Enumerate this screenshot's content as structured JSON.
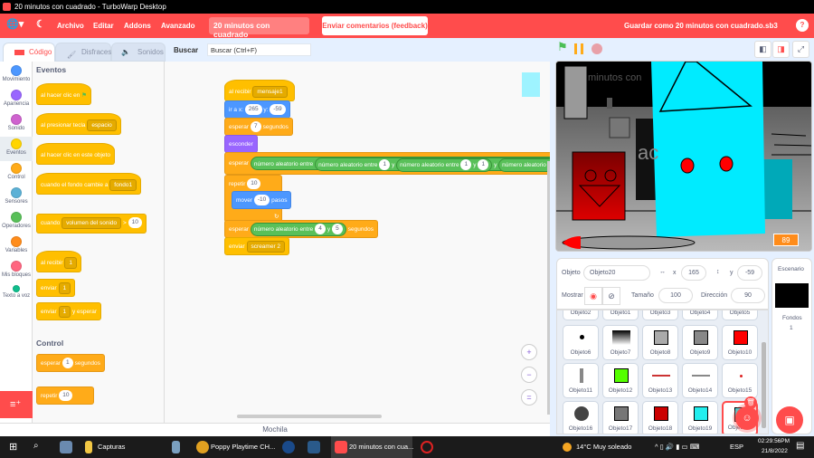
{
  "window": {
    "title": "20 minutos con cuadrado - TurboWarp Desktop"
  },
  "menubar": {
    "items": [
      "Archivo",
      "Editar",
      "Addons",
      "Avanzado"
    ],
    "project_title": "20 minutos con cuadrado",
    "feedback": "Enviar comentarios (feedback)",
    "save": "Guardar como 20 minutos con cuadrado.sb3",
    "help": "?"
  },
  "tabs": [
    {
      "label": "Código"
    },
    {
      "label": "Disfraces"
    },
    {
      "label": "Sonidos"
    }
  ],
  "search": {
    "label": "Buscar",
    "placeholder": "Buscar (Ctrl+F)"
  },
  "categories": [
    {
      "label": "Movimiento",
      "color": "#4c97ff"
    },
    {
      "label": "Apariencia",
      "color": "#9966ff"
    },
    {
      "label": "Sonido",
      "color": "#cf63cf"
    },
    {
      "label": "Eventos",
      "color": "#ffd500"
    },
    {
      "label": "Control",
      "color": "#ffab19"
    },
    {
      "label": "Sensores",
      "color": "#5cb1d6"
    },
    {
      "label": "Operadores",
      "color": "#59c059"
    },
    {
      "label": "Variables",
      "color": "#ff8c1a"
    },
    {
      "label": "Mis bloques",
      "color": "#ff6680"
    },
    {
      "label": "Texto a voz",
      "color": "#0fbd8c"
    }
  ],
  "palette": {
    "events_header": "Eventos",
    "control_header": "Control",
    "b1": "al hacer clic en",
    "b2": "al presionar tecla",
    "b2dd": "espacio",
    "b3": "al hacer clic en este objeto",
    "b4": "cuando el fondo cambie a",
    "b4dd": "fondo1",
    "b5": "cuando",
    "b5dd": "volumen del sonido",
    "b5op": ">",
    "b5v": "10",
    "b6": "al recibir",
    "b6dd": "1",
    "b7": "enviar",
    "b7dd": "1",
    "b8": "enviar",
    "b8dd": "1",
    "b8b": "y esperar",
    "c1": "esperar",
    "c1v": "1",
    "c1b": "segundos",
    "c2": "repetir",
    "c2v": "10"
  },
  "script": {
    "recv": "al recibir",
    "recv_dd": "mensaje1",
    "goto": "ir a x:",
    "gx": "265",
    "gy_lbl": "y:",
    "gy": "-59",
    "wait": "esperar",
    "wait_v": "7",
    "secs": "segundos",
    "hide": "esconder",
    "wait2": "esperar",
    "rand": "número aleatorio entre",
    "y": "y",
    "one": "1",
    "repeat": "repetir",
    "repeat_v": "10",
    "move": "mover",
    "move_v": "-10",
    "steps": "pasos",
    "wait3": "esperar",
    "r4": "4",
    "r5": "5",
    "secs3": "segundos",
    "send": "enviar",
    "send_dd": "screamer 2"
  },
  "zoom": {
    "in": "+",
    "out": "−",
    "reset": "="
  },
  "mochila": "Mochila",
  "stage": {
    "counter": "89",
    "bg_text1": "minutos con",
    "bg_text2": "ac"
  },
  "sprite_info": {
    "object_label": "Objeto",
    "name": "Objeto20",
    "x_label": "x",
    "x": "165",
    "y_label": "y",
    "y": "-59",
    "show_label": "Mostrar",
    "size_label": "Tamaño",
    "size": "100",
    "direction_label": "Dirección",
    "direction": "90"
  },
  "sprites": {
    "partial": [
      "Objeto2",
      "Objeto1",
      "Objeto3",
      "Objeto4",
      "Objeto5"
    ],
    "rows": [
      [
        "Objeto6",
        "Objeto7",
        "Objeto8",
        "Objeto9",
        "Objeto10"
      ],
      [
        "Objeto11",
        "Objeto12",
        "Objeto13",
        "Objeto14",
        "Objeto15"
      ],
      [
        "Objeto16",
        "Objeto17",
        "Objeto18",
        "Objeto19",
        "Objeto20"
      ]
    ],
    "selected": "Objeto20"
  },
  "stage_panel": {
    "title": "Escenario",
    "backdrops_label": "Fondos",
    "backdrops": "1"
  },
  "taskbar": {
    "apps": [
      "Capturas",
      "Poppy Playtime CH...",
      "20 minutos con cua..."
    ],
    "weather": "14°C  Muy soleado",
    "lang": "ESP",
    "time": "02:29:56PM",
    "date": "21/8/2022"
  },
  "colors": {
    "accent": "#ff4c4c",
    "events": "#ffbf00",
    "control": "#ffab19",
    "motion": "#4c97ff",
    "looks": "#9966ff",
    "operators": "#59c059"
  }
}
